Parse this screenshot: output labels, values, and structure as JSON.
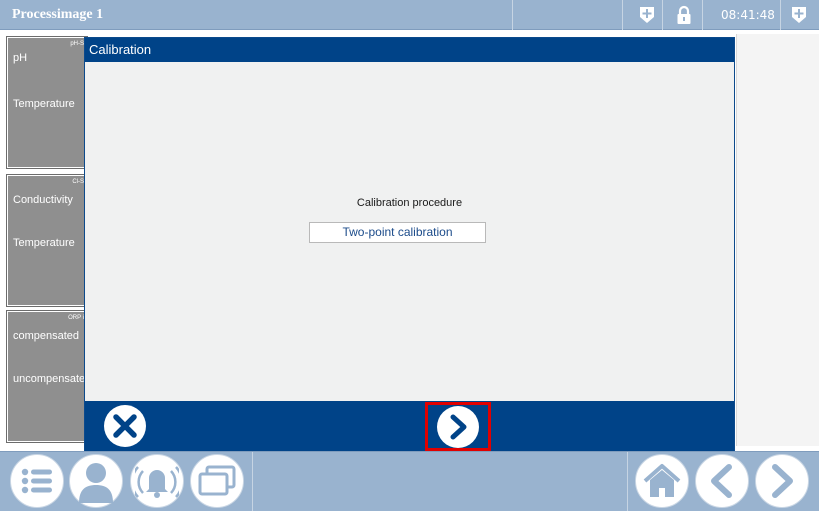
{
  "topbar": {
    "title": "Processimage 1",
    "time": "08:41:48",
    "icons": [
      "add-shield-icon",
      "lock-icon",
      "add-shield-icon"
    ]
  },
  "panels": [
    {
      "tag": "pH-S",
      "line1": "pH",
      "line2": "Temperature"
    },
    {
      "tag": "Cl-S",
      "line1": "Conductivity",
      "line2": "Temperature"
    },
    {
      "tag": "ORP i",
      "line1": "compensated",
      "line2": "uncompensated"
    }
  ],
  "dialog": {
    "title": "Calibration",
    "procedure_label": "Calibration procedure",
    "procedure_value": "Two-point calibration",
    "cancel_icon": "close-icon",
    "next_icon": "chevron-right-icon"
  },
  "bottombar": {
    "left_icons": [
      "menu-list-icon",
      "user-icon",
      "alarm-bell-icon",
      "windows-icon"
    ],
    "right_icons": [
      "home-icon",
      "back-icon",
      "forward-icon"
    ]
  },
  "colors": {
    "bar": "#99b3cf",
    "dialog_header": "#004388",
    "panel": "#8f8f8f",
    "highlight": "#e00000"
  }
}
